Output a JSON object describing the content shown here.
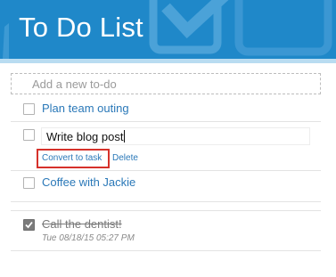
{
  "header": {
    "title": "To Do List"
  },
  "new_todo": {
    "placeholder": "Add a new to-do"
  },
  "todos": [
    {
      "label": "Plan team outing",
      "checked": false
    },
    {
      "label": "Write blog post",
      "checked": false,
      "editing": true,
      "actions": {
        "convert": "Convert to task",
        "delete": "Delete"
      }
    },
    {
      "label": "Coffee with Jackie",
      "checked": false
    }
  ],
  "completed": [
    {
      "label": "Call the dentist!",
      "checked": true,
      "timestamp": "Tue 08/18/15 05:27 PM"
    }
  ],
  "colors": {
    "header": "#1f88c9",
    "link": "#2a78b8",
    "highlight": "#d6312b"
  }
}
